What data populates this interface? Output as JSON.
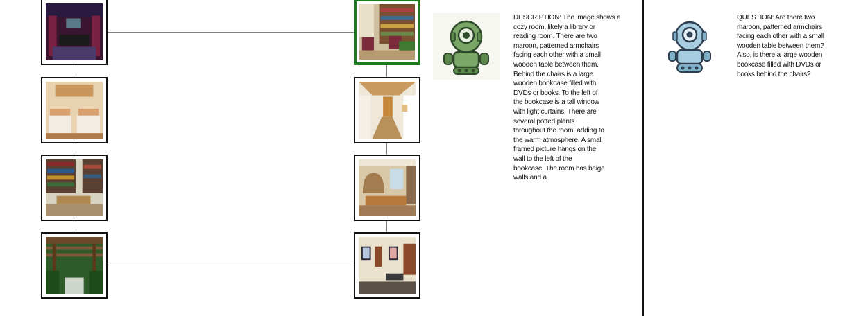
{
  "grid": {
    "left_column": [
      {
        "id": "L1",
        "scene": "home-theater-image",
        "selected": false
      },
      {
        "id": "L2",
        "scene": "twin-bedroom-image",
        "selected": false
      },
      {
        "id": "L3",
        "scene": "library-study-image",
        "selected": false
      },
      {
        "id": "L4",
        "scene": "pergola-garden-image",
        "selected": false
      }
    ],
    "right_column": [
      {
        "id": "R1",
        "scene": "library-reading-room-image",
        "selected": true
      },
      {
        "id": "R2",
        "scene": "hallway-image",
        "selected": false
      },
      {
        "id": "R3",
        "scene": "living-room-image",
        "selected": false
      },
      {
        "id": "R4",
        "scene": "office-lobby-image",
        "selected": false
      }
    ]
  },
  "colors": {
    "selected_border": "#1f7a1f",
    "connector": "#808080",
    "green_robot": "#6f9a5b",
    "blue_robot": "#9fc4d6"
  },
  "description_panel": {
    "icon": "green-robot-icon",
    "text": "DESCRIPTION: The image shows a\ncozy room, likely a library or\nreading room. There are two\nmaroon, patterned armchairs\nfacing each other with a small\nwooden table between them.\nBehind the chairs is a large\nwooden bookcase filled with\nDVDs or books. To the left of\nthe bookcase is a tall window\nwith light curtains. There are\nseveral potted plants\nthroughout the room, adding to\nthe warm atmosphere. A small\nframed picture hangs on the\nwall to the left of the\nbookcase. The room has beige\nwalls and a"
  },
  "question_panel": {
    "icon": "blue-robot-icon",
    "text": "QUESTION: Are there two\nmaroon, patterned armchairs\nfacing each other with a small\nwooden table between them?\nAlso, is there a large wooden\nbookcase filled with DVDs or\nbooks behind the chairs?"
  }
}
